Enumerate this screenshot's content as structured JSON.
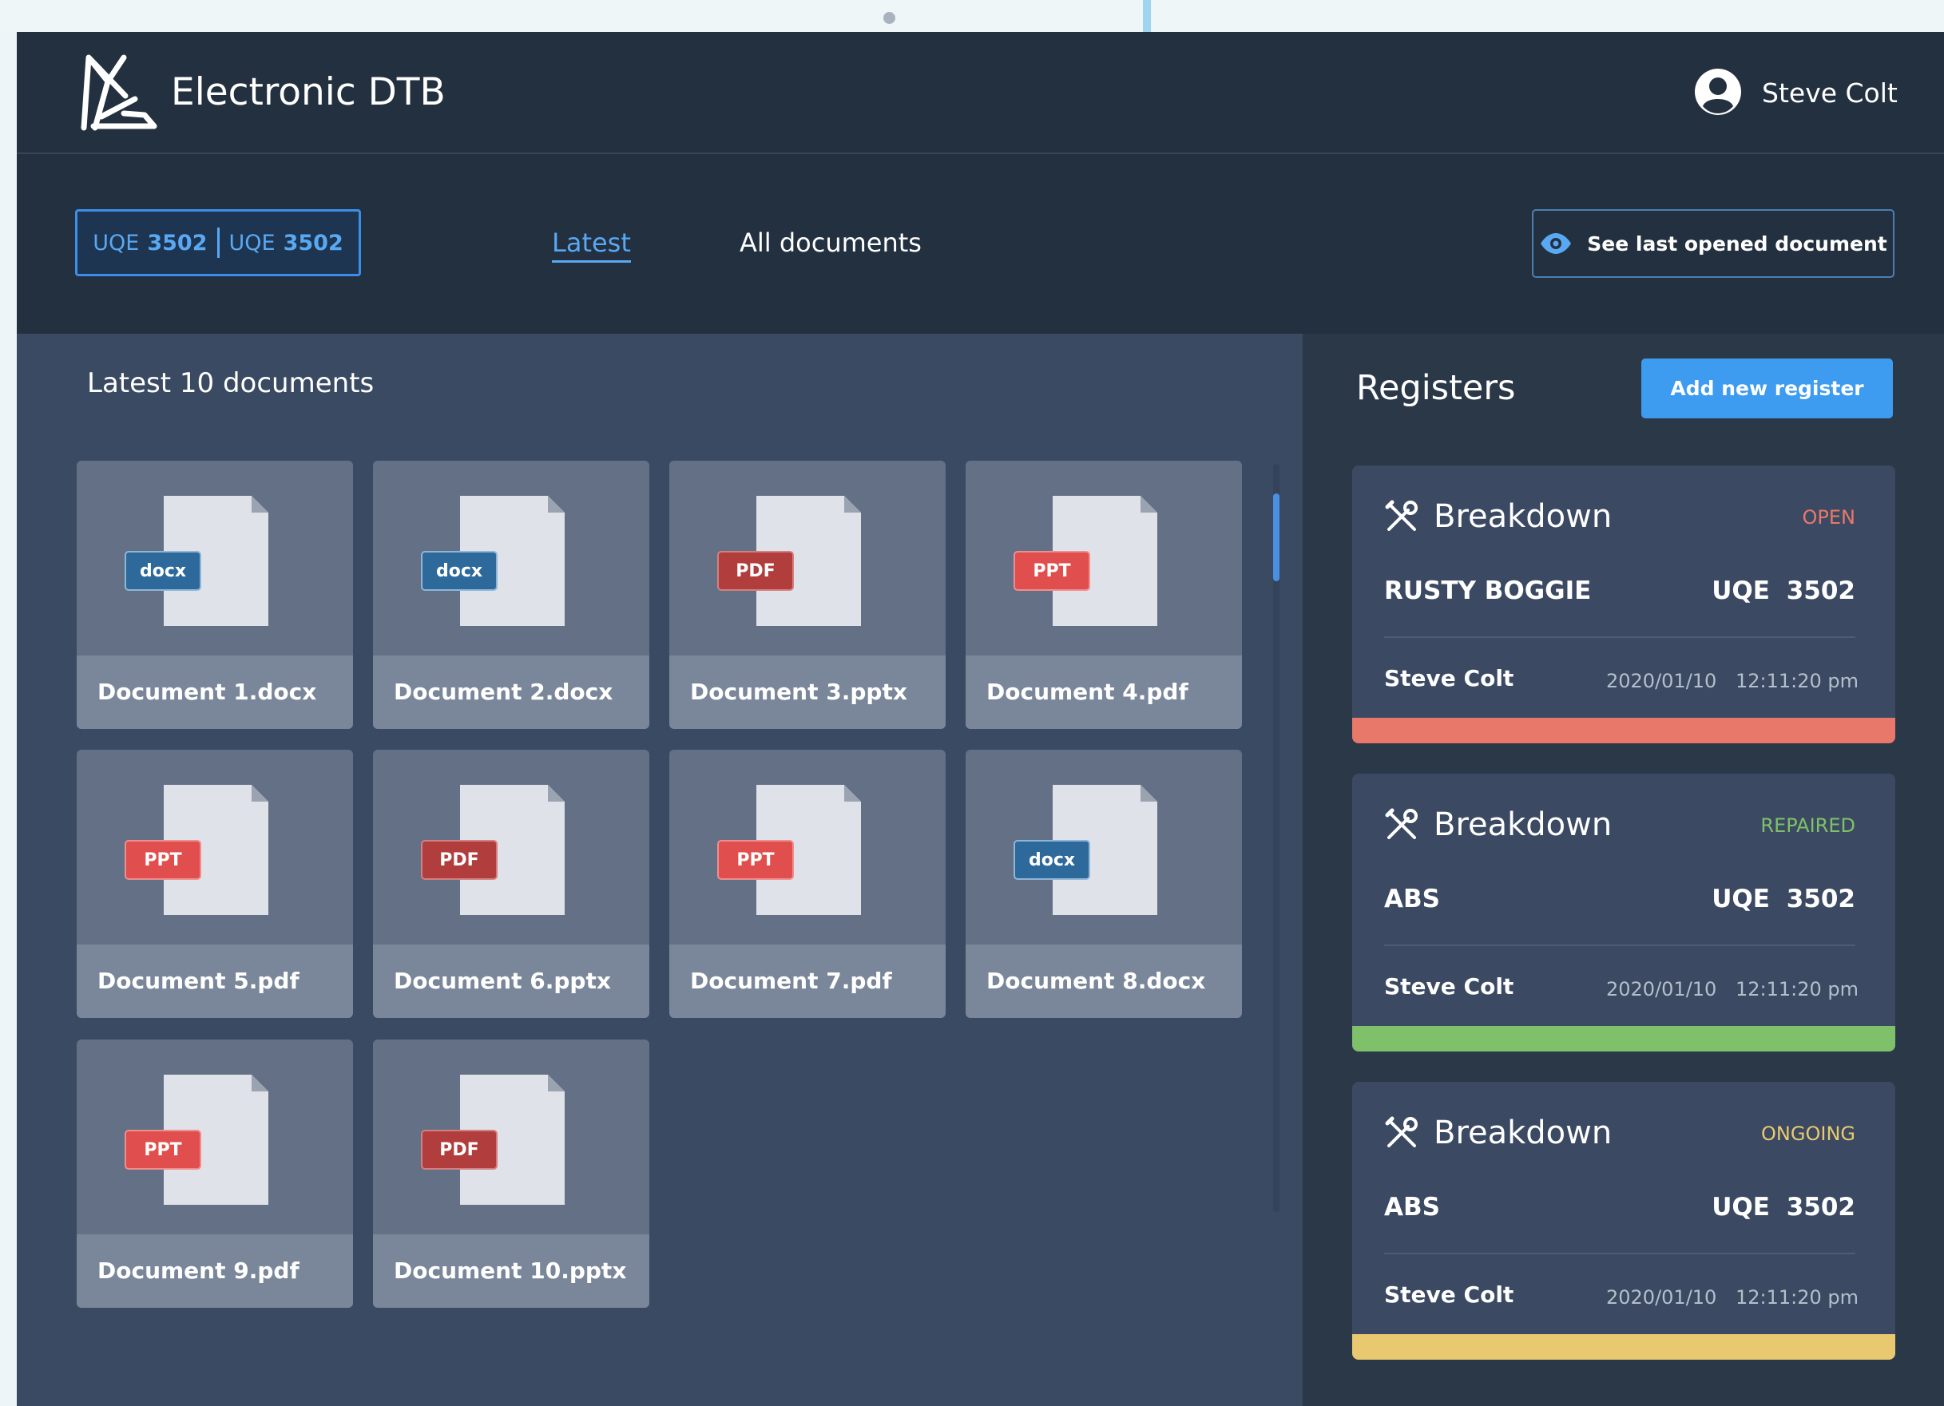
{
  "app": {
    "title": "Electronic DTB"
  },
  "user": {
    "name": "Steve Colt"
  },
  "toolbar": {
    "vehicle_pill": [
      {
        "prefix": "UQE",
        "number": "3502"
      },
      {
        "prefix": "UQE",
        "number": "3502"
      }
    ],
    "tabs": [
      {
        "label": "Latest",
        "active": true
      },
      {
        "label": "All documents",
        "active": false
      }
    ],
    "last_opened_label": "See last opened document"
  },
  "documents": {
    "title": "Latest 10 documents",
    "items": [
      {
        "name": "Document 1.docx",
        "badge": "docx",
        "kind": "docx"
      },
      {
        "name": "Document 2.docx",
        "badge": "docx",
        "kind": "docx"
      },
      {
        "name": "Document 3.pptx",
        "badge": "PDF",
        "kind": "pdf"
      },
      {
        "name": "Document 4.pdf",
        "badge": "PPT",
        "kind": "ppt"
      },
      {
        "name": "Document 5.pdf",
        "badge": "PPT",
        "kind": "ppt"
      },
      {
        "name": "Document 6.pptx",
        "badge": "PDF",
        "kind": "pdf"
      },
      {
        "name": "Document 7.pdf",
        "badge": "PPT",
        "kind": "ppt"
      },
      {
        "name": "Document 8.docx",
        "badge": "docx",
        "kind": "docx"
      },
      {
        "name": "Document 9.pdf",
        "badge": "PPT",
        "kind": "ppt"
      },
      {
        "name": "Document 10.pptx",
        "badge": "PDF",
        "kind": "pdf"
      }
    ]
  },
  "registers": {
    "title": "Registers",
    "add_label": "Add new register",
    "items": [
      {
        "type": "Breakdown",
        "status": "OPEN",
        "status_color": "#e8796a",
        "part": "RUSTY BOGGIE",
        "vehicle": "UQE 3502",
        "user": "Steve Colt",
        "date": "2020/01/10",
        "time": "12:11:20 pm"
      },
      {
        "type": "Breakdown",
        "status": "REPAIRED",
        "status_color": "#7fc06a",
        "part": "ABS",
        "vehicle": "UQE 3502",
        "user": "Steve Colt",
        "date": "2020/01/10",
        "time": "12:11:20 pm"
      },
      {
        "type": "Breakdown",
        "status": "ONGOING",
        "status_color": "#e8c96f",
        "part": "ABS",
        "vehicle": "UQE 3502",
        "user": "Steve Colt",
        "date": "2020/01/10",
        "time": "12:11:20 pm"
      }
    ]
  },
  "colors": {
    "accent": "#3d9bf0",
    "header_bg": "#23303f",
    "content_bg": "#3a4a62",
    "registers_bg": "#2b3848"
  }
}
